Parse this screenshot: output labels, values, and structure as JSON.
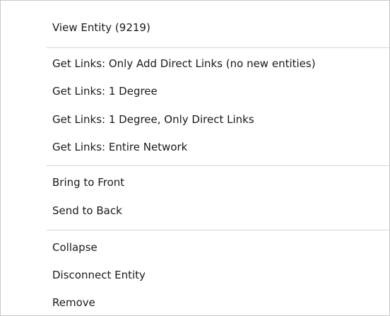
{
  "menu": {
    "groups": [
      {
        "items": [
          {
            "label": "View Entity (9219)"
          }
        ]
      },
      {
        "items": [
          {
            "label": "Get Links: Only Add Direct Links (no new entities)"
          },
          {
            "label": "Get Links: 1 Degree"
          },
          {
            "label": "Get Links: 1 Degree, Only Direct Links"
          },
          {
            "label": "Get Links: Entire Network"
          }
        ]
      },
      {
        "items": [
          {
            "label": "Bring to Front"
          },
          {
            "label": "Send to Back"
          }
        ]
      },
      {
        "items": [
          {
            "label": "Collapse"
          },
          {
            "label": "Disconnect Entity"
          },
          {
            "label": "Remove"
          }
        ]
      }
    ]
  }
}
